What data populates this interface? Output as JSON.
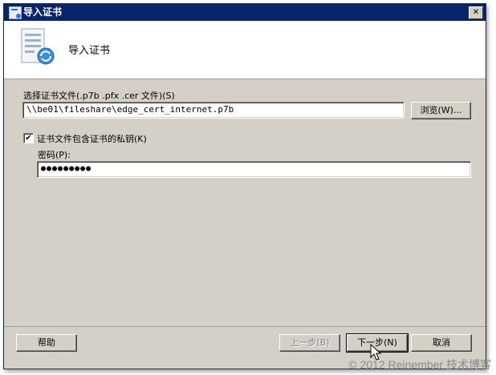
{
  "window": {
    "title": "导入证书",
    "close_glyph": "✕"
  },
  "header": {
    "title": "导入证书",
    "icon": "certificate-import-icon"
  },
  "file": {
    "label": "选择证书文件(.p7b .pfx .cer 文件)(S)",
    "value": "\\\\be01\\fileshare\\edge_cert_internet.p7b",
    "browse_label": "浏览(W)..."
  },
  "private_key": {
    "checkbox_label": "证书文件包含证书的私钥(K)",
    "checked": true,
    "check_glyph": "✔",
    "password_label": "密码(P):",
    "password_value": "●●●●●●●●●"
  },
  "footer": {
    "help_label": "帮助",
    "back_label": "上一步(B)",
    "next_label": "下一步(N)",
    "cancel_label": "取消"
  },
  "watermark": "© 2012 Reinember 技术博客",
  "colors": {
    "titlebar": "#0a246a",
    "dialog_bg": "#d4d0c8",
    "header_bg": "#ffffff"
  }
}
